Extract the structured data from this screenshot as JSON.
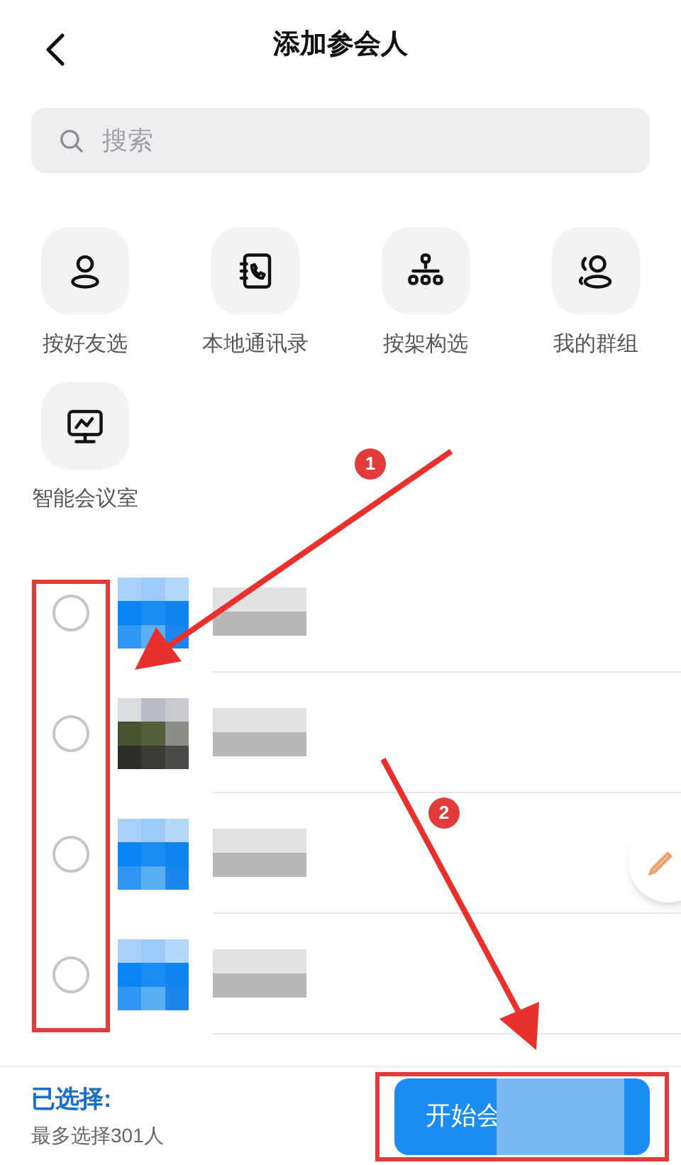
{
  "header": {
    "title": "添加参会人"
  },
  "search": {
    "placeholder": "搜索"
  },
  "shortcuts": [
    {
      "kind": "person",
      "label": "按好友选"
    },
    {
      "kind": "phonebook",
      "label": "本地通讯录"
    },
    {
      "kind": "org",
      "label": "按架构选"
    },
    {
      "kind": "group",
      "label": "我的群组"
    },
    {
      "kind": "monitor",
      "label": "智能会议室"
    }
  ],
  "contacts": [
    {
      "selected": false
    },
    {
      "selected": false
    },
    {
      "selected": false
    },
    {
      "selected": false
    }
  ],
  "footer": {
    "title": "已选择:",
    "hint": "最多选择301人",
    "button": "开始会"
  },
  "annotations": [
    {
      "label": "1"
    },
    {
      "label": "2"
    }
  ]
}
